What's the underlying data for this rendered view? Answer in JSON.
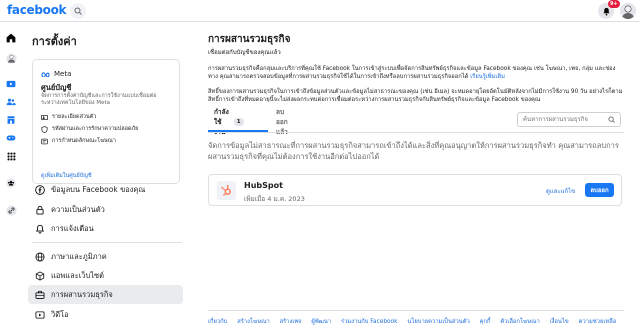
{
  "topbar": {
    "logo_text": "facebook",
    "notification_count": "9+",
    "brand_color": "#1877f2",
    "badge_color": "#e41e3f"
  },
  "rail": {
    "icons": [
      "home-icon",
      "profile-icon",
      "watch-icon",
      "friends-icon",
      "marketplace-icon",
      "gaming-icon",
      "menu-grid-icon",
      "groups-icon",
      "link-icon"
    ]
  },
  "sidebar": {
    "title": "การตั้งค่า",
    "meta_card": {
      "logo_label": "Meta",
      "title": "ศูนย์บัญชี",
      "description": "จัดการการตั้งค่าบัญชีและการใช้งานแบบเชื่อมต่อระหว่างเทคโนโลยีของ Meta",
      "rows": [
        {
          "label": "รายละเอียดส่วนตัว",
          "icon": "person-card-icon"
        },
        {
          "label": "รหัสผ่านและการรักษาความปลอดภัย",
          "icon": "shield-icon"
        },
        {
          "label": "การกำหนดลักษณะโฆษณา",
          "icon": "ad-icon"
        }
      ],
      "link": "ดูเพิ่มเติมในศูนย์บัญชี"
    },
    "menu": [
      {
        "label": "ข้อมูลบน Facebook ของคุณ",
        "icon": "facebook-circle-icon"
      },
      {
        "label": "ความเป็นส่วนตัว",
        "icon": "lock-icon"
      },
      {
        "label": "การแจ้งเตือน",
        "icon": "bell-icon"
      },
      {
        "label": "ภาษาและภูมิภาค",
        "icon": "globe-icon"
      },
      {
        "label": "แอพและเว็บไซต์",
        "icon": "cube-icon"
      },
      {
        "label": "การผสานรวมธุรกิจ",
        "icon": "briefcase-icon"
      },
      {
        "label": "วิดีโอ",
        "icon": "video-icon"
      }
    ]
  },
  "main": {
    "title": "การผสานรวมธุรกิจ",
    "subtitle": "เชื่อมต่อกับบัญชีของคุณแล้ว",
    "para1": "การผสานรวมธุรกิจคือกลุ่มและบริการที่คุณใช้ Facebook ในการเข้าสู่ระบบเพื่อจัดการสินทรัพย์ธุรกิจและข้อมูล Facebook ของคุณ เช่น โฆษณา, เพจ, กลุ่ม และช่องทาง คุณสามารถตรวจสอบข้อมูลที่การผสานรวมธุรกิจใช้ได้ในการเข้าถึงหรือลบการผสานรวมธุรกิจออกได้",
    "para1_link": "เรียนรู้เพิ่มเติม",
    "para2": "สิทธิ์ของการผสานรวมธุรกิจในการเข้าถึงข้อมูลส่วนตัวและข้อมูลไม่สาธารณะของคุณ (เช่น อีเมล) จะหมดอายุโดยอัตโนมัติหลังจากไม่มีการใช้งาน 90 วัน อย่างไรก็ตาม สิทธิ์การเข้าถึงที่หมดอายุนี้จะไม่ส่งผลกระทบต่อการเชื่อมต่อระหว่างการผสานรวมธุรกิจกับสินทรัพย์ธุรกิจและข้อมูล Facebook ของคุณ",
    "tabs": [
      {
        "label": "กำลังใช้งาน",
        "count": "1"
      },
      {
        "label": "ลบออกแล้ว"
      }
    ],
    "search_placeholder": "ค้นหาการผสานรวมธุรกิจ",
    "info": "จัดการข้อมูลไม่สาธารณะที่การผสานรวมธุรกิจสามารถเข้าถึงได้และสิ่งที่คุณอนุญาตให้การผสานรวมธุรกิจทำ คุณสามารถลบการผสานรวมธุรกิจที่คุณไม่ต้องการใช้งานอีกต่อไปออกได้",
    "app": {
      "name": "HubSpot",
      "logo_text": "HubSpot",
      "added": "เพิ่มเมื่อ 4 ม.ค. 2023",
      "view_label": "ดูและแก้ไข",
      "remove_label": "ลบออก"
    },
    "footer_links": [
      "เกี่ยวกับ",
      "สร้างโฆษณา",
      "สร้างเพจ",
      "ผู้พัฒนา",
      "ร่วมงานกับ Facebook",
      "นโยบายความเป็นส่วนตัว",
      "คุกกี้",
      "ตัวเลือกโฆษณา",
      "เงื่อนไข",
      "ความช่วยเหลือ"
    ]
  }
}
